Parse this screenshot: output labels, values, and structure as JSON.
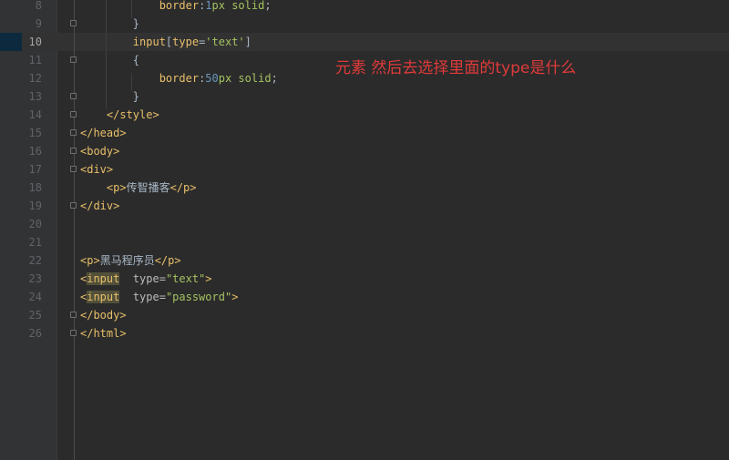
{
  "editor": {
    "lines": [
      {
        "num": "8",
        "parts": [
          {
            "t": "            "
          },
          {
            "t": "border",
            "c": "prop"
          },
          {
            "t": ":"
          },
          {
            "t": "1",
            "c": "num"
          },
          {
            "t": "px solid",
            "c": "val"
          },
          {
            "t": ";"
          }
        ]
      },
      {
        "num": "9",
        "parts": [
          {
            "t": "        }"
          }
        ]
      },
      {
        "num": "10",
        "parts": [
          {
            "t": "        "
          },
          {
            "t": "input",
            "c": "sel"
          },
          {
            "t": "["
          },
          {
            "t": "type",
            "c": "sel"
          },
          {
            "t": "="
          },
          {
            "t": "'text'",
            "c": "str"
          },
          {
            "t": "]"
          }
        ]
      },
      {
        "num": "11",
        "parts": [
          {
            "t": "        {"
          }
        ]
      },
      {
        "num": "12",
        "parts": [
          {
            "t": "            "
          },
          {
            "t": "border",
            "c": "prop"
          },
          {
            "t": ":"
          },
          {
            "t": "50",
            "c": "num"
          },
          {
            "t": "px solid",
            "c": "val"
          },
          {
            "t": ";"
          }
        ]
      },
      {
        "num": "13",
        "parts": [
          {
            "t": "        }"
          }
        ]
      },
      {
        "num": "14",
        "parts": [
          {
            "t": "    "
          },
          {
            "t": "</style>",
            "c": "tag"
          }
        ]
      },
      {
        "num": "15",
        "parts": [
          {
            "t": "</head>",
            "c": "tag"
          }
        ]
      },
      {
        "num": "16",
        "parts": [
          {
            "t": "<body>",
            "c": "tag"
          }
        ]
      },
      {
        "num": "17",
        "parts": [
          {
            "t": "<div>",
            "c": "tag"
          }
        ]
      },
      {
        "num": "18",
        "parts": [
          {
            "t": "    "
          },
          {
            "t": "<p>",
            "c": "tag"
          },
          {
            "t": "传智播客"
          },
          {
            "t": "</p>",
            "c": "tag"
          }
        ]
      },
      {
        "num": "19",
        "parts": [
          {
            "t": "</div>",
            "c": "tag"
          }
        ]
      },
      {
        "num": "20",
        "parts": []
      },
      {
        "num": "21",
        "parts": []
      },
      {
        "num": "22",
        "parts": [
          {
            "t": "<p>",
            "c": "tag"
          },
          {
            "t": "黑马程序员"
          },
          {
            "t": "</p>",
            "c": "tag"
          }
        ]
      },
      {
        "num": "23",
        "parts": [
          {
            "t": "<",
            "c": "tag"
          },
          {
            "t": "input",
            "c": "tag hl"
          },
          {
            "t": "  "
          },
          {
            "t": "type=",
            "c": "attr"
          },
          {
            "t": "\"text\"",
            "c": "str"
          },
          {
            "t": ">",
            "c": "tag"
          }
        ]
      },
      {
        "num": "24",
        "parts": [
          {
            "t": "<",
            "c": "tag"
          },
          {
            "t": "input",
            "c": "tag hl"
          },
          {
            "t": "  "
          },
          {
            "t": "type=",
            "c": "attr"
          },
          {
            "t": "\"password\"",
            "c": "str"
          },
          {
            "t": ">",
            "c": "tag"
          }
        ]
      },
      {
        "num": "25",
        "parts": [
          {
            "t": "</body>",
            "c": "tag"
          }
        ]
      },
      {
        "num": "26",
        "parts": [
          {
            "t": "</html>",
            "c": "tag"
          }
        ]
      }
    ],
    "current_line": "10",
    "fold_marker_lines": [
      "9",
      "11",
      "13",
      "14",
      "15",
      "16",
      "17",
      "19",
      "25",
      "26"
    ]
  },
  "annotation": {
    "text": "元素 然后去选择里面的type是什么",
    "color": "#e03a3a"
  },
  "colors": {
    "background": "#2b2b2b",
    "gutter": "#313335",
    "tag": "#e8bf6a",
    "string": "#a5c261",
    "number": "#6897bb",
    "text": "#a9b7c6"
  }
}
